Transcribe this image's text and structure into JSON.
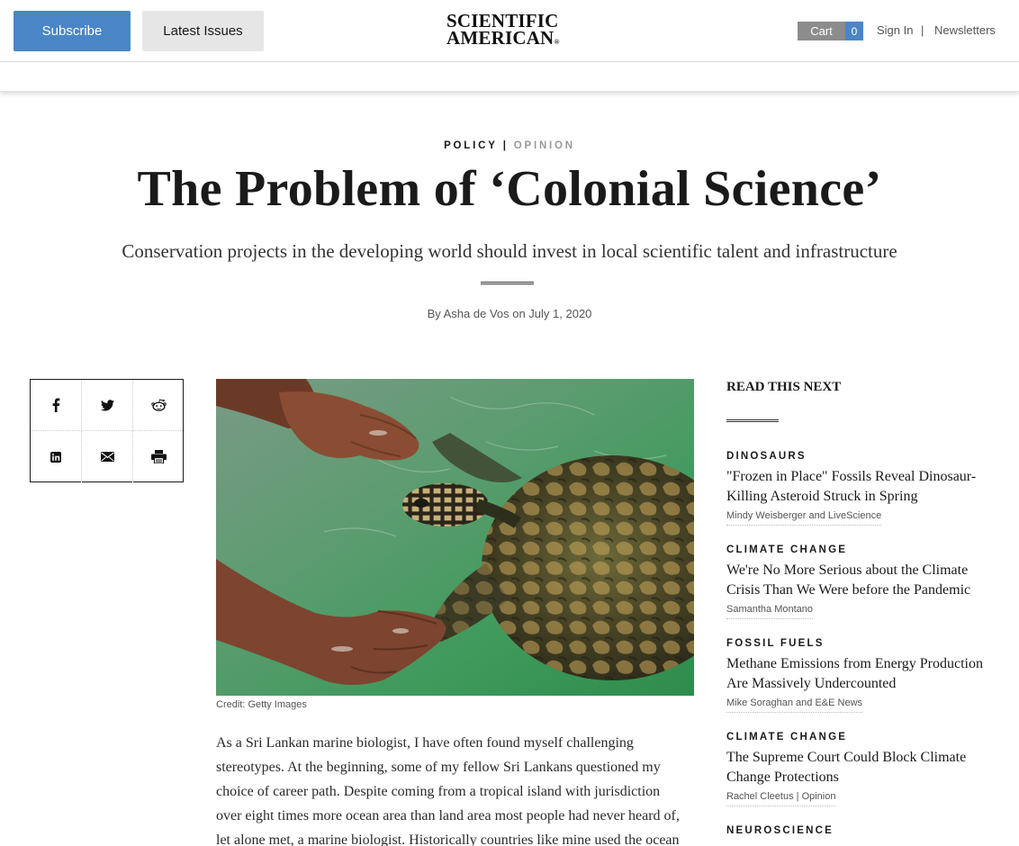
{
  "header": {
    "subscribe_label": "Subscribe",
    "latest_issues_label": "Latest Issues",
    "logo_line1": "SCIENTIFIC",
    "logo_line2": "AMERICAN",
    "logo_mark": "®",
    "cart_label": "Cart",
    "cart_count": "0",
    "sign_in_label": "Sign In",
    "separator": "|",
    "newsletters_label": "Newsletters"
  },
  "article": {
    "category": "POLICY",
    "category_separator": "|",
    "section": "OPINION",
    "title": "The Problem of ‘Colonial Science’",
    "subtitle": "Conservation projects in the developing world should invest in local scientific talent and infrastructure",
    "byline": "By Asha de Vos on July 1, 2020",
    "image_credit": "Credit: Getty Images",
    "body_lines": [
      "As a Sri Lankan marine biologist, I have often found myself challenging",
      "stereotypes. At the beginning, some of my fellow Sri Lankans questioned my",
      "choice of career path. Despite coming from a tropical island with jurisdiction",
      "over eight times more ocean area than land area most people had never heard of,",
      "let alone met, a marine biologist. Historically countries like mine used the ocean"
    ]
  },
  "share": {
    "icons": [
      "facebook-icon",
      "twitter-icon",
      "reddit-icon",
      "linkedin-icon",
      "email-icon",
      "print-icon"
    ]
  },
  "sidebar": {
    "heading": "READ THIS NEXT",
    "items": [
      {
        "category": "DINOSAURS",
        "title": "\"Frozen in Place\" Fossils Reveal Dinosaur-Killing Asteroid Struck in Spring",
        "author": "Mindy Weisberger and LiveScience"
      },
      {
        "category": "CLIMATE CHANGE",
        "title": "We're No More Serious about the Climate Crisis Than We Were before the Pandemic",
        "author": "Samantha Montano"
      },
      {
        "category": "FOSSIL FUELS",
        "title": "Methane Emissions from Energy Production Are Massively Undercounted",
        "author": "Mike Soraghan and E&E News"
      },
      {
        "category": "CLIMATE CHANGE",
        "title": "The Supreme Court Could Block Climate Change Protections",
        "author": "Rachel Cleetus | Opinion"
      },
      {
        "category": "NEUROSCIENCE",
        "title": "",
        "author": ""
      }
    ]
  },
  "colors": {
    "accent_blue": "#4a86c5",
    "cart_gray": "#8c8c8c",
    "water_green": "#4f9a66"
  }
}
